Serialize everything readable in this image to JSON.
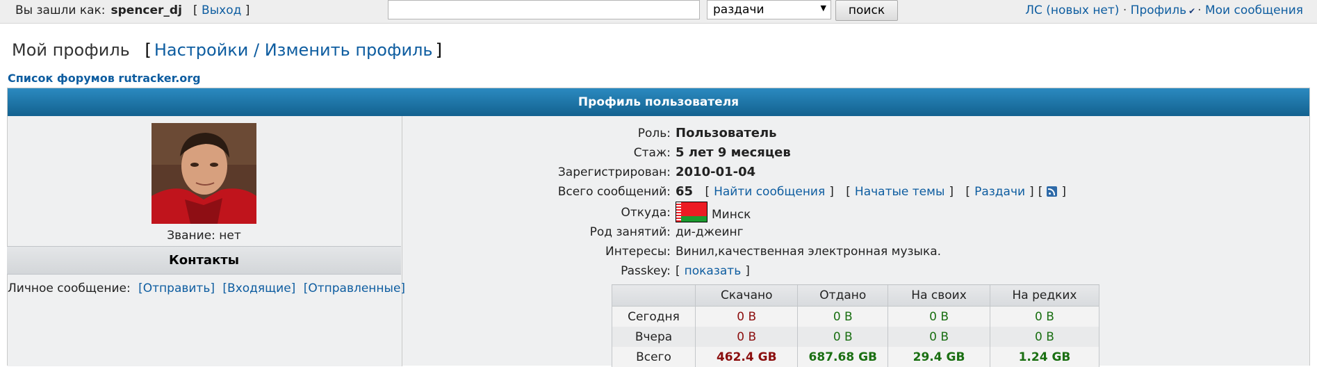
{
  "topbar": {
    "login_prefix": "Вы зашли как:",
    "username": "spencer_dj",
    "logout_label": "Выход",
    "search_placeholder": "",
    "search_scope": "раздачи",
    "search_button": "поиск",
    "pm_link": "ЛС (новых нет)",
    "profile_link": "Профиль",
    "my_posts_link": "Мои сообщения"
  },
  "page": {
    "title": "Мой профиль",
    "settings_link": "Настройки / Изменить профиль",
    "forum_index_link": "Список форумов rutracker.org"
  },
  "profile": {
    "box_title": "Профиль пользователя",
    "rank_text": "Звание: нет",
    "contacts_title": "Контакты",
    "pm_label": "Личное сообщение:",
    "pm_send": "[Отправить]",
    "pm_inbox": "[Входящие]",
    "pm_sent": "[Отправленные]",
    "fields": {
      "role_label": "Роль:",
      "role_value": "Пользователь",
      "tenure_label": "Стаж:",
      "tenure_value": "5 лет 9 месяцев",
      "registered_label": "Зарегистрирован:",
      "registered_value": "2010-01-04",
      "posts_label": "Всего сообщений:",
      "posts_value": "65",
      "find_posts": "Найти сообщения",
      "started_topics": "Начатые темы",
      "releases": "Раздачи",
      "from_label": "Откуда:",
      "from_value": "Минск",
      "occupation_label": "Род занятий:",
      "occupation_value": "ди-джеинг",
      "interests_label": "Интересы:",
      "interests_value": "Винил,качественная электронная музыка.",
      "passkey_label": "Passkey:",
      "passkey_show": "показать"
    },
    "stats": {
      "headers": [
        "",
        "Скачано",
        "Отдано",
        "На своих",
        "На редких"
      ],
      "rows": [
        {
          "label": "Сегодня",
          "values": [
            "0 B",
            "0 B",
            "0 B",
            "0 B"
          ]
        },
        {
          "label": "Вчера",
          "values": [
            "0 B",
            "0 B",
            "0 B",
            "0 B"
          ]
        },
        {
          "label": "Всего",
          "values": [
            "462.4 GB",
            "687.68 GB",
            "29.4 GB",
            "1.24 GB"
          ]
        }
      ]
    }
  },
  "colors": {
    "header_blue": "#1a6fa3",
    "link": "#0e5da0",
    "downloaded": "#8b0e0e",
    "uploaded": "#1a6f12"
  }
}
